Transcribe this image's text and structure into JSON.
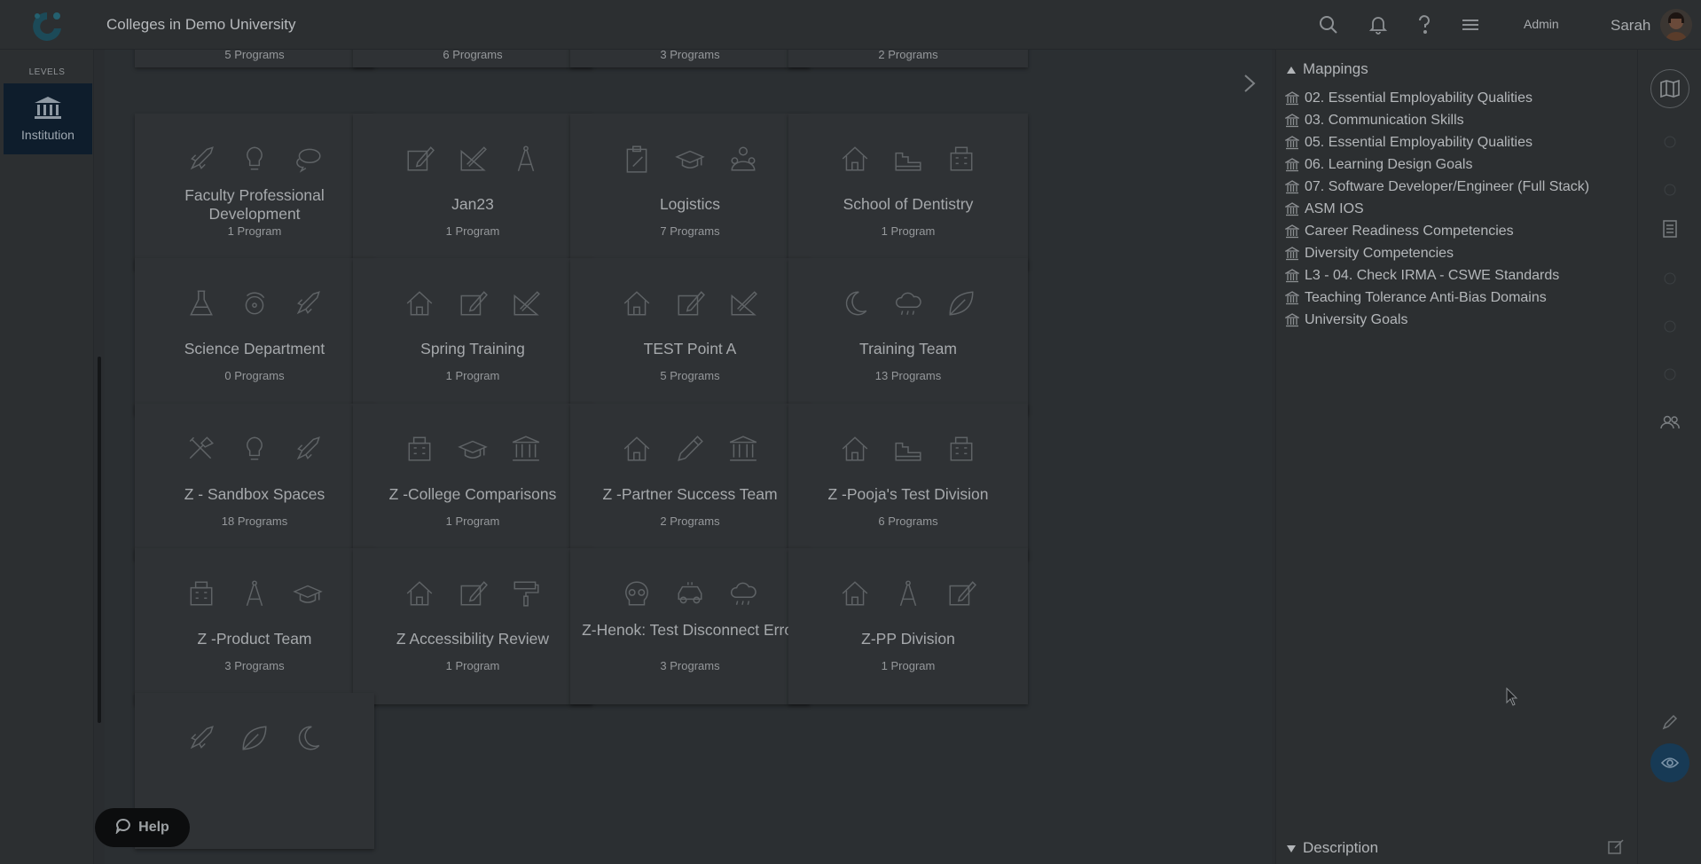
{
  "header": {
    "title": "Colleges in Demo University",
    "role_label": "Admin",
    "user_name": "Sarah"
  },
  "left_rail": {
    "levels_label": "LEVELS",
    "institution_label": "Institution"
  },
  "cards_partial_top": [
    "5 Programs",
    "6 Programs",
    "3 Programs",
    "2 Programs"
  ],
  "cards": [
    {
      "name": "Faculty Professional Development",
      "count": "1 Program",
      "icons": [
        "rocket-icon",
        "lightbulb-icon",
        "chat-icon"
      ]
    },
    {
      "name": "Jan23",
      "count": "1 Program",
      "icons": [
        "edit-icon",
        "pencil-ruler-icon",
        "compass-icon"
      ]
    },
    {
      "name": "Logistics",
      "count": "7 Programs",
      "icons": [
        "clipboard-icon",
        "graduation-cap-icon",
        "people-icon"
      ]
    },
    {
      "name": "School of Dentistry",
      "count": "1 Program",
      "icons": [
        "home-icon",
        "skyline-icon",
        "building-icon"
      ]
    },
    {
      "name": "Science Department",
      "count": "0 Programs",
      "icons": [
        "flask-icon",
        "atom-icon",
        "rocket-icon"
      ]
    },
    {
      "name": "Spring Training",
      "count": "1 Program",
      "icons": [
        "home-icon",
        "edit-icon",
        "pencil-ruler-icon"
      ]
    },
    {
      "name": "TEST Point A",
      "count": "5 Programs",
      "icons": [
        "home-icon",
        "edit-icon",
        "pencil-ruler-icon"
      ]
    },
    {
      "name": "Training Team",
      "count": "13 Programs",
      "icons": [
        "moon-icon",
        "cloud-rain-icon",
        "leaf-icon"
      ]
    },
    {
      "name": "Z - Sandbox Spaces",
      "count": "18 Programs",
      "icons": [
        "tools-icon",
        "lightbulb-icon",
        "rocket-icon"
      ]
    },
    {
      "name": "Z -College Comparisons",
      "count": "1 Program",
      "icons": [
        "building-icon",
        "graduation-cap-icon",
        "institution-icon"
      ]
    },
    {
      "name": "Z -Partner Success Team",
      "count": "2 Programs",
      "icons": [
        "home-icon",
        "pencil-icon",
        "institution-icon"
      ]
    },
    {
      "name": "Z -Pooja's Test Division",
      "count": "6 Programs",
      "icons": [
        "home-icon",
        "skyline-icon",
        "building-icon"
      ]
    },
    {
      "name": "Z -Product Team",
      "count": "3 Programs",
      "icons": [
        "building-icon",
        "compass-icon",
        "graduation-cap-icon"
      ]
    },
    {
      "name": "Z Accessibility Review",
      "count": "1 Program",
      "icons": [
        "home-icon",
        "edit-icon",
        "paint-roller-icon"
      ]
    },
    {
      "name": "Z-Henok: Test Disconnect Error",
      "count": "3 Programs",
      "icons": [
        "skull-icon",
        "car-icon",
        "cloud-rain-icon"
      ]
    },
    {
      "name": "Z-PP Division",
      "count": "1 Program",
      "icons": [
        "home-icon",
        "compass-icon",
        "edit-icon"
      ]
    }
  ],
  "right_panel": {
    "mappings_title": "Mappings",
    "mappings": [
      "02. Essential Employability Qualities",
      "03. Communication Skills",
      "05. Essential Employability Qualities",
      "06. Learning Design Goals",
      "07. Software Developer/Engineer (Full Stack)",
      "ASM IOS",
      "Career Readiness Competencies",
      "Diversity Competencies",
      "L3 - 04. Check IRMA - CSWE Standards",
      "Teaching Tolerance Anti-Bias Domains",
      "University Goals"
    ],
    "description_title": "Description"
  },
  "help_label": "Help",
  "colors": {
    "overlay_bg": "#2a2d30",
    "institution_active": "#0e1d2c",
    "view_button": "#173a55"
  }
}
